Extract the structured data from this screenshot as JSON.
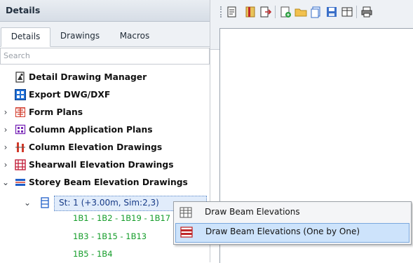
{
  "panel": {
    "title": "Details"
  },
  "tabs": [
    {
      "label": "Details"
    },
    {
      "label": "Drawings"
    },
    {
      "label": "Macros"
    }
  ],
  "search": {
    "placeholder": "Search"
  },
  "tree": {
    "items": [
      {
        "label": "Detail Drawing Manager"
      },
      {
        "label": "Export DWG/DXF"
      },
      {
        "label": "Form Plans"
      },
      {
        "label": "Column Application Plans"
      },
      {
        "label": "Column Elevation Drawings"
      },
      {
        "label": "Shearwall Elevation Drawings"
      },
      {
        "label": "Storey Beam Elevation Drawings"
      }
    ],
    "storey": {
      "label": "St: 1 (+3.00m, Sim:2,3)"
    },
    "leaves": [
      {
        "label": "1B1 - 1B2 - 1B19 - 1B17"
      },
      {
        "label": "1B3 - 1B15 - 1B13"
      },
      {
        "label": "1B5 - 1B4"
      }
    ]
  },
  "context_menu": {
    "items": [
      {
        "label": "Draw Beam Elevations"
      },
      {
        "label": "Draw Beam Elevations (One by One)"
      }
    ]
  }
}
